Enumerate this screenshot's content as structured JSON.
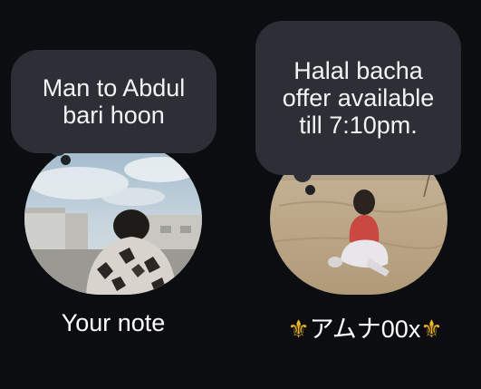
{
  "notes": [
    {
      "note_text": "Man to Abdul bari hoon",
      "label": "Your note"
    },
    {
      "note_text": "Halal bacha offer available till 7:10pm.",
      "label_prefix": "⚜",
      "label_name": "アムナ00x",
      "label_suffix": "⚜"
    }
  ],
  "colors": {
    "background": "#0b0d10",
    "bubble": "#2c3036",
    "text": "#ffffff",
    "emblem": "#f0b52a"
  }
}
